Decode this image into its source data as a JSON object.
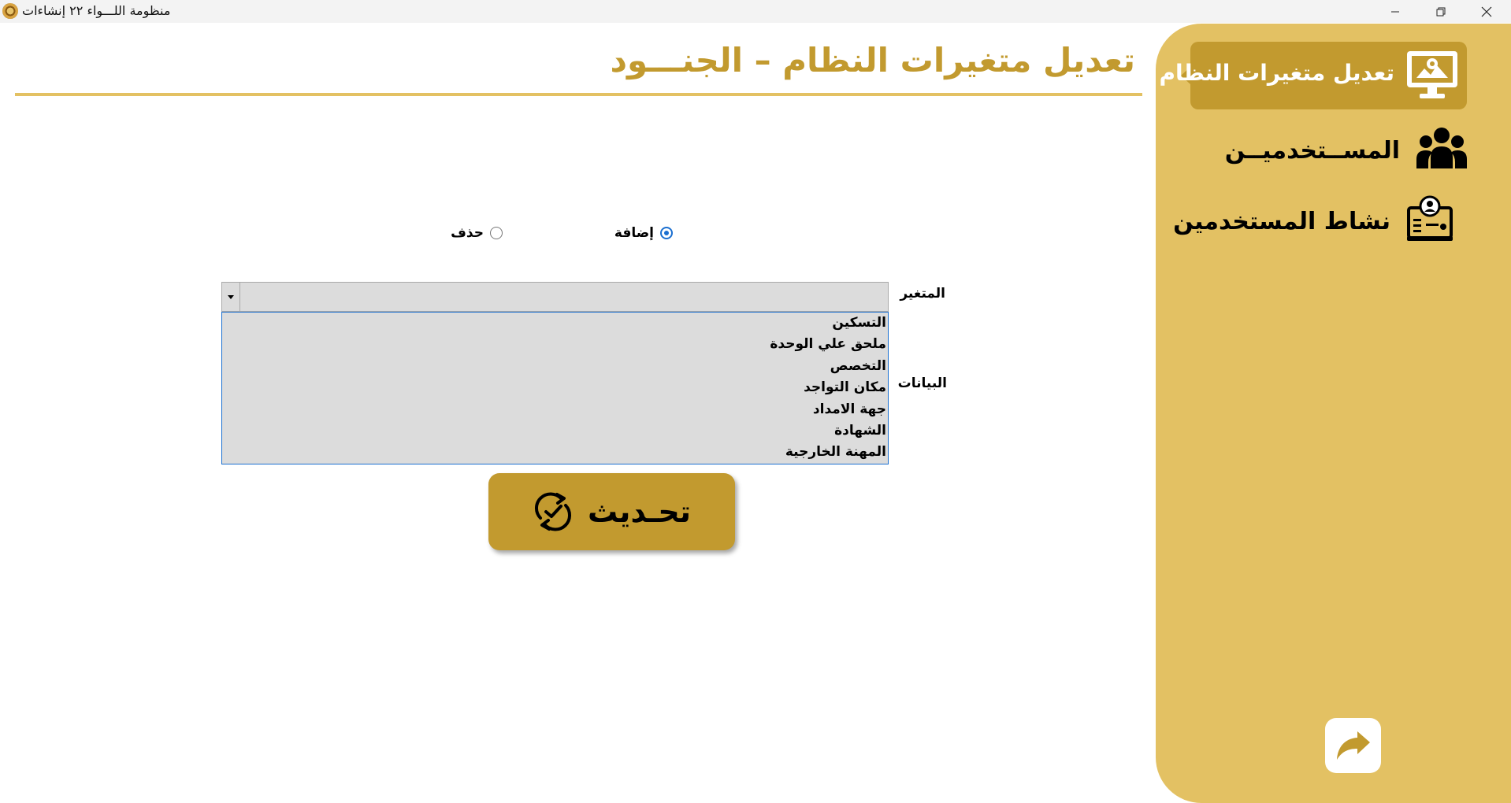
{
  "window": {
    "title": "منظومة اللـــواء ٢٢ إنشاءات"
  },
  "sidebar": {
    "items": [
      {
        "label": "تعديل متغيرات النظام",
        "icon": "monitor-settings-icon",
        "active": true
      },
      {
        "label": "المســتخدميــن",
        "icon": "users-group-icon",
        "active": false
      },
      {
        "label": "نشاط المستخدمين",
        "icon": "user-activity-icon",
        "active": false
      }
    ],
    "back_icon": "share-forward-icon"
  },
  "main": {
    "title": "تعديل متغيرات النظام – الجنـــود",
    "mode": {
      "add_label": "إضافة",
      "delete_label": "حذف",
      "selected": "add"
    },
    "variable": {
      "label": "المتغير",
      "value": "",
      "options": [
        "التسكين",
        "ملحق علي الوحدة",
        "التخصص",
        "مكان التواجد",
        "جهة الامداد",
        "الشهادة",
        "المهنة الخارجية"
      ]
    },
    "data_label": "البيانات",
    "refresh_label": "تحـديث"
  },
  "colors": {
    "gold_dark": "#c29a2f",
    "gold_light": "#e3c163",
    "accent_blue": "#1b6fd0"
  }
}
